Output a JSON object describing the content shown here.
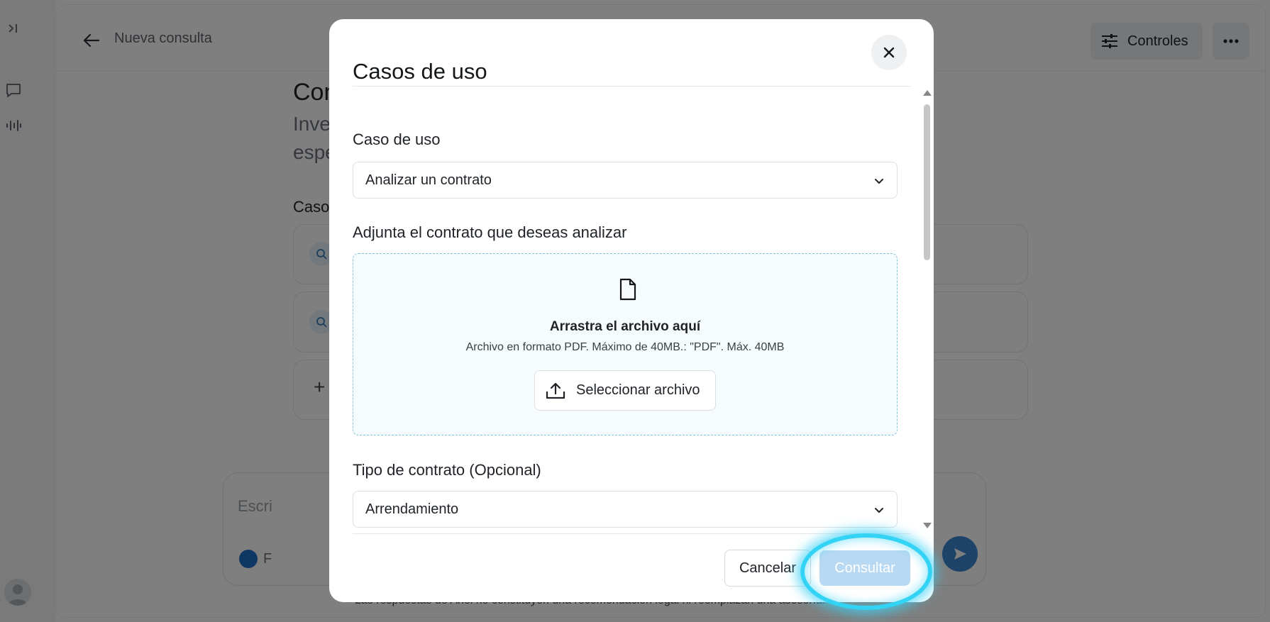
{
  "app": {
    "title": "Nueva consulta",
    "controls_label": "Controles",
    "heading_partial": "Con",
    "subtitle_line1_partial": "Inve",
    "subtitle_line2_partial": "espe",
    "cases_heading_partial": "Caso",
    "composer_placeholder_partial": "Escri",
    "composer_footer_partial": "F",
    "disclaimer": "Las respuestas de Ariel no constituyen una recomendación legal ni reemplazan una asesoría."
  },
  "modal": {
    "title": "Casos de uso",
    "use_case": {
      "label": "Caso de uso",
      "value": "Analizar un contrato"
    },
    "upload": {
      "label": "Adjunta el contrato que deseas analizar",
      "title": "Arrastra el archivo aquí",
      "subtitle": "Archivo en formato PDF. Máximo de 40MB.: \"PDF\". Máx. 40MB",
      "button_label": "Seleccionar archivo"
    },
    "contract_type": {
      "label": "Tipo de contrato (Opcional)",
      "value": "Arrendamiento"
    },
    "cancel_label": "Cancelar",
    "submit_label": "Consultar"
  },
  "colors": {
    "overlay": "rgba(0,0,0,0.5)",
    "submit_disabled": "#b9d9f2",
    "dropzone_border": "#7fc3dd",
    "highlight": "#33d3f5"
  }
}
